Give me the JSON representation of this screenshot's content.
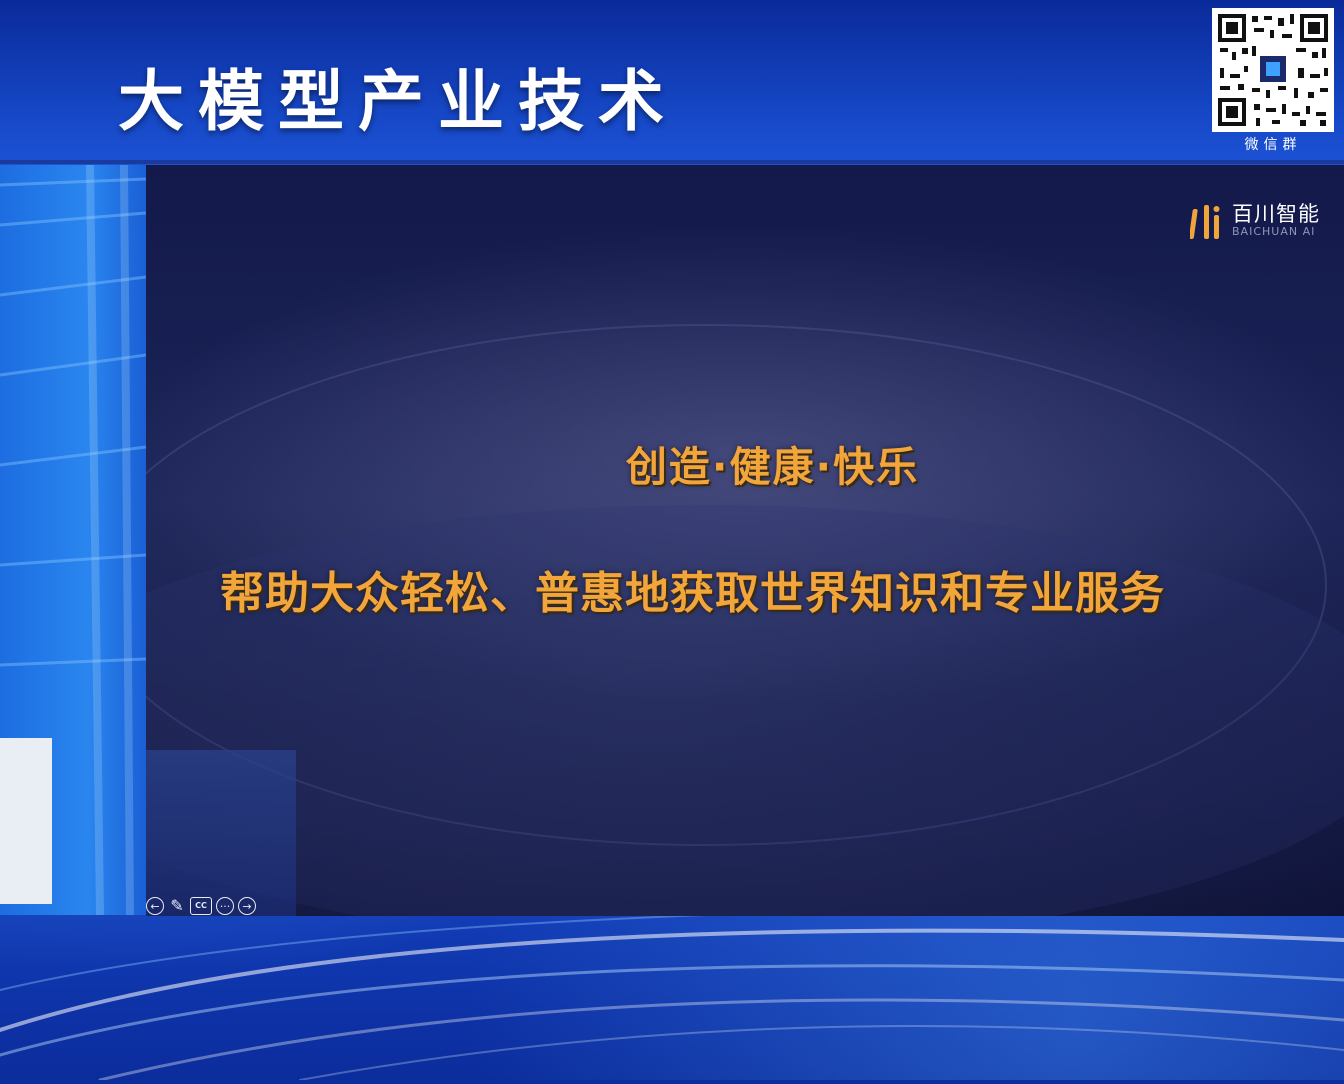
{
  "header": {
    "title": "大模型产业技术",
    "qr_label": "微信群"
  },
  "slide": {
    "brand_cn": "百川智能",
    "brand_en": "BAICHUAN AI",
    "slogan_line1": "创造·健康·快乐",
    "slogan_line2": "帮助大众轻松、普惠地获取世界知识和专业服务"
  },
  "controls": {
    "prev": "←",
    "pen": "✎",
    "cc": "CC",
    "more": "···",
    "next": "→"
  },
  "colors": {
    "title": "#ffffff",
    "slogan": "#f2a53a",
    "slide_bg": "#151b4c",
    "stage_blue": "#1a4fd6"
  }
}
